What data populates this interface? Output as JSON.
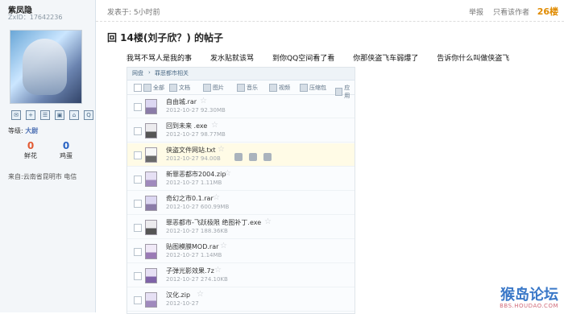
{
  "left_panel": {
    "username": "紫凤隐",
    "uid": "ZxID：17642236",
    "rank_label": "等级:",
    "rank_value": "大尉",
    "stats": [
      {
        "value": "0",
        "label": "鲜花"
      },
      {
        "value": "0",
        "label": "鸡蛋"
      }
    ],
    "from": "来自:云南省昆明市 电信"
  },
  "post_header": {
    "posted": "发表于: 5小时前",
    "report": "举报",
    "only_author": "只看该作者",
    "floor": "26楼"
  },
  "post": {
    "title": "回 14楼(刘子欣？) 的帖子",
    "quotes": [
      "我骂不骂人是我的事",
      "发水贴就该骂",
      "到你QQ空间看了看",
      "你那侠盗飞车弱爆了",
      "告诉你什么叫做侠盗飞"
    ]
  },
  "disk": {
    "breadcrumbs": [
      "网盘",
      "罪恶都市相关"
    ],
    "toolbar": [
      "全部",
      "文档",
      "图片",
      "音乐",
      "视频",
      "压缩包",
      "应用"
    ],
    "files": [
      {
        "name": "自由城.rar",
        "date": "2012-10-27",
        "size": "92.30MB",
        "type": "rar"
      },
      {
        "name": "回到未来 .exe",
        "date": "2012-10-27",
        "size": "98.77MB",
        "type": "exe"
      },
      {
        "name": "侠盗文件网站.txt",
        "date": "2012-10-27",
        "size": "94.00B",
        "type": "txt"
      },
      {
        "name": "新罪恶都市2004.zip",
        "date": "2012-10-27",
        "size": "1.11MB",
        "type": "zip"
      },
      {
        "name": "奇幻之市0.1.rar",
        "date": "2012-10-27",
        "size": "600.99MB",
        "type": "rar"
      },
      {
        "name": "罪恶都市-飞跃极限 绝图补丁.exe",
        "date": "2012-10-27",
        "size": "188.36KB",
        "type": "exe"
      },
      {
        "name": "贴图模膜MOD.rar",
        "date": "2012-10-27",
        "size": "1.14MB",
        "type": "mod"
      },
      {
        "name": "子弹光影效果.7z",
        "date": "2012-10-27",
        "size": "274.10KB",
        "type": "7z"
      },
      {
        "name": "汉化.zip",
        "date": "2012-10-27",
        "size": "",
        "type": "zip"
      }
    ]
  },
  "watermark": {
    "main": "猴岛论坛",
    "sub": "BBS.HOUDAO.COM"
  }
}
